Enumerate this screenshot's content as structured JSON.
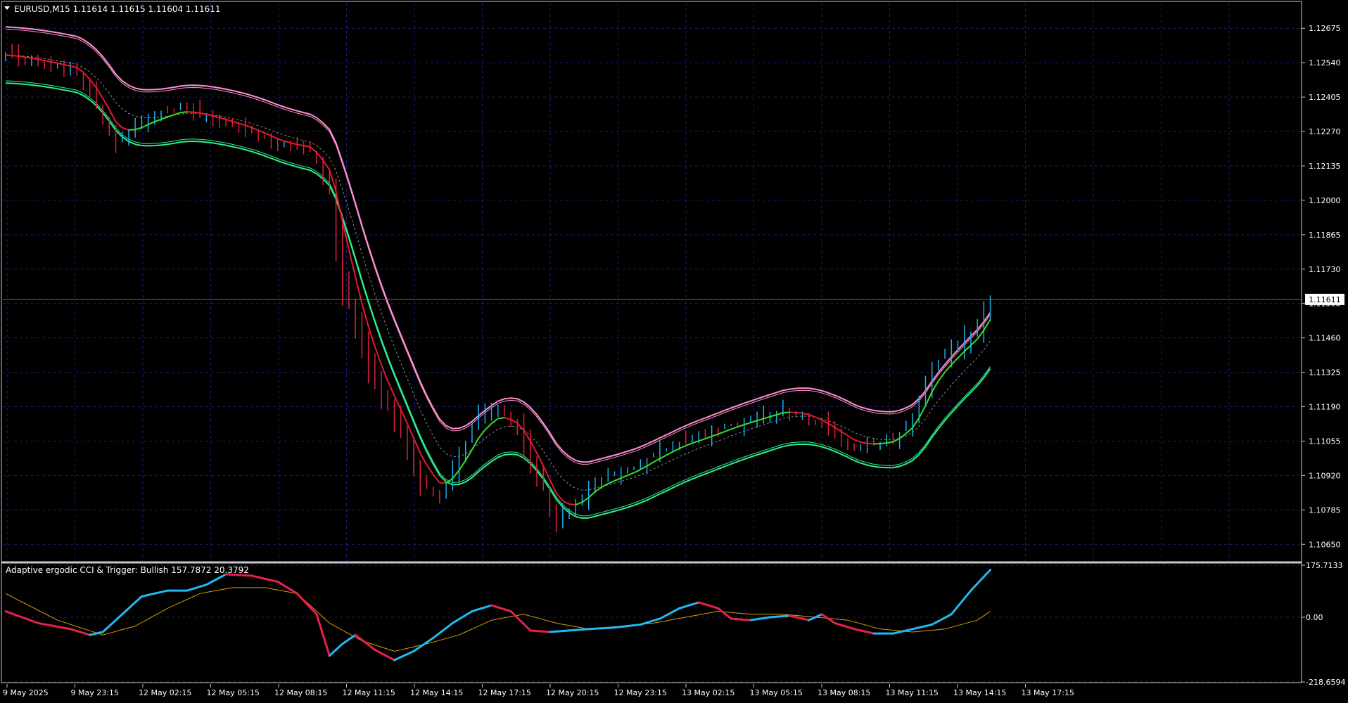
{
  "symbol_label": "EURUSD,M15  1.11614 1.11615 1.11604 1.11611",
  "indicator_label": "Adaptive ergodic CCI & Trigger: Bullish 157.7872 20.3792",
  "current_price_label": "1.11611",
  "colors": {
    "background": "#000000",
    "grid": "#1d1d6b",
    "frame": "#c8c8c8",
    "candle_up": "#1ab0e8",
    "candle_down": "#e0203a",
    "band_pink": "#ff8fd0",
    "band_green": "#2cf08a",
    "trend_green": "#33e02c",
    "trend_red": "#e81a2a",
    "mid_line": "#8a8a8a",
    "cci_up": "#22b8f0",
    "cci_down": "#e8204a",
    "trigger": "#d8a000"
  },
  "chart_data": [
    {
      "type": "candlestick",
      "title": "EURUSD,M15",
      "y_ticks": [
        "1.12675",
        "1.12540",
        "1.12405",
        "1.12270",
        "1.12135",
        "1.12000",
        "1.11865",
        "1.11730",
        "1.11595",
        "1.11460",
        "1.11325",
        "1.11190",
        "1.11055",
        "1.10920",
        "1.10785",
        "1.10650"
      ],
      "y_tick_values": [
        1.12675,
        1.1254,
        1.12405,
        1.1227,
        1.12135,
        1.12,
        1.11865,
        1.1173,
        1.11595,
        1.1146,
        1.11325,
        1.1119,
        1.11055,
        1.1092,
        1.10785,
        1.1065
      ],
      "ylim": [
        1.1059,
        1.12775
      ],
      "current_price": 1.11611,
      "x_ticks": [
        "9 May 2025",
        "9 May 23:15",
        "12 May 02:15",
        "12 May 05:15",
        "12 May 08:15",
        "12 May 11:15",
        "12 May 14:15",
        "12 May 17:15",
        "12 May 20:15",
        "12 May 23:15",
        "13 May 02:15",
        "13 May 05:15",
        "13 May 08:15",
        "13 May 11:15",
        "13 May 14:15",
        "13 May 17:15"
      ],
      "bar_count": 160,
      "price_path": [
        [
          0,
          1.1257
        ],
        [
          6,
          1.1254
        ],
        [
          11,
          1.1251
        ],
        [
          14,
          1.1238
        ],
        [
          17,
          1.1222
        ],
        [
          22,
          1.1232
        ],
        [
          27,
          1.1236
        ],
        [
          32,
          1.1232
        ],
        [
          37,
          1.1228
        ],
        [
          42,
          1.1222
        ],
        [
          47,
          1.122
        ],
        [
          50,
          1.1205
        ],
        [
          52,
          1.117
        ],
        [
          55,
          1.114
        ],
        [
          58,
          1.1122
        ],
        [
          61,
          1.1108
        ],
        [
          64,
          1.109
        ],
        [
          67,
          1.1083
        ],
        [
          70,
          1.11
        ],
        [
          73,
          1.1115
        ],
        [
          76,
          1.1118
        ],
        [
          79,
          1.111
        ],
        [
          82,
          1.1092
        ],
        [
          85,
          1.1075
        ],
        [
          88,
          1.108
        ],
        [
          91,
          1.109
        ],
        [
          94,
          1.1092
        ],
        [
          97,
          1.1095
        ],
        [
          100,
          1.11
        ],
        [
          104,
          1.1105
        ],
        [
          108,
          1.1108
        ],
        [
          112,
          1.1112
        ],
        [
          116,
          1.1115
        ],
        [
          120,
          1.1118
        ],
        [
          124,
          1.1115
        ],
        [
          128,
          1.1108
        ],
        [
          131,
          1.1103
        ],
        [
          134,
          1.1104
        ],
        [
          137,
          1.1106
        ],
        [
          140,
          1.1115
        ],
        [
          143,
          1.1135
        ],
        [
          147,
          1.1143
        ],
        [
          150,
          1.115
        ],
        [
          152,
          1.1161
        ]
      ]
    },
    {
      "type": "line",
      "title": "Adaptive ergodic CCI & Trigger",
      "y_ticks": [
        "175.7133",
        "0.00",
        "-218.6594"
      ],
      "y_tick_values": [
        175.7133,
        0,
        -218.6594
      ],
      "ylim": [
        -218.6594,
        175.7133
      ],
      "series": [
        {
          "name": "Adaptive ergodic CCI",
          "points": [
            [
              0,
              20
            ],
            [
              5,
              -20
            ],
            [
              10,
              -40
            ],
            [
              13,
              -60
            ],
            [
              15,
              -50
            ],
            [
              18,
              10
            ],
            [
              21,
              70
            ],
            [
              25,
              90
            ],
            [
              28,
              90
            ],
            [
              31,
              110
            ],
            [
              34,
              145
            ],
            [
              38,
              140
            ],
            [
              42,
              120
            ],
            [
              45,
              80
            ],
            [
              48,
              10
            ],
            [
              50,
              -130
            ],
            [
              52,
              -90
            ],
            [
              54,
              -60
            ],
            [
              57,
              -110
            ],
            [
              60,
              -145
            ],
            [
              63,
              -115
            ],
            [
              66,
              -70
            ],
            [
              69,
              -20
            ],
            [
              72,
              20
            ],
            [
              75,
              40
            ],
            [
              78,
              20
            ],
            [
              81,
              -45
            ],
            [
              84,
              -50
            ],
            [
              87,
              -45
            ],
            [
              90,
              -40
            ],
            [
              94,
              -35
            ],
            [
              98,
              -25
            ],
            [
              101,
              -5
            ],
            [
              104,
              30
            ],
            [
              107,
              50
            ],
            [
              110,
              30
            ],
            [
              112,
              -5
            ],
            [
              115,
              -10
            ],
            [
              118,
              0
            ],
            [
              121,
              5
            ],
            [
              124,
              -10
            ],
            [
              126,
              10
            ],
            [
              128,
              -20
            ],
            [
              131,
              -40
            ],
            [
              134,
              -55
            ],
            [
              137,
              -55
            ],
            [
              140,
              -40
            ],
            [
              143,
              -25
            ],
            [
              146,
              10
            ],
            [
              149,
              90
            ],
            [
              152,
              160
            ]
          ]
        },
        {
          "name": "Trigger",
          "points": [
            [
              0,
              80
            ],
            [
              8,
              -10
            ],
            [
              15,
              -60
            ],
            [
              20,
              -30
            ],
            [
              25,
              30
            ],
            [
              30,
              80
            ],
            [
              35,
              100
            ],
            [
              40,
              100
            ],
            [
              45,
              80
            ],
            [
              50,
              -20
            ],
            [
              55,
              -80
            ],
            [
              60,
              -115
            ],
            [
              65,
              -90
            ],
            [
              70,
              -60
            ],
            [
              75,
              -10
            ],
            [
              80,
              10
            ],
            [
              85,
              -20
            ],
            [
              90,
              -40
            ],
            [
              95,
              -30
            ],
            [
              100,
              -20
            ],
            [
              105,
              0
            ],
            [
              110,
              20
            ],
            [
              115,
              10
            ],
            [
              120,
              10
            ],
            [
              125,
              0
            ],
            [
              130,
              -10
            ],
            [
              135,
              -40
            ],
            [
              140,
              -50
            ],
            [
              145,
              -40
            ],
            [
              150,
              -10
            ],
            [
              152,
              20
            ]
          ]
        }
      ]
    }
  ]
}
